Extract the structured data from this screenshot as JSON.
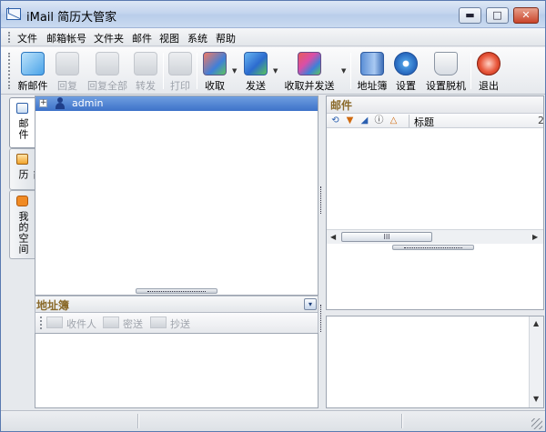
{
  "window": {
    "title": "iMail 简历大管家",
    "minimize": "▬",
    "maximize": "□",
    "close": "✕"
  },
  "menu": {
    "items": [
      "文件",
      "邮箱帐号",
      "文件夹",
      "邮件",
      "视图",
      "系统",
      "帮助"
    ]
  },
  "toolbar": {
    "new_mail": "新邮件",
    "reply": "回复",
    "reply_all": "回复全部",
    "forward": "转发",
    "print": "打印",
    "receive": "收取",
    "send": "发送",
    "receive_send": "收取并发送",
    "address_book": "地址簿",
    "settings": "设置",
    "offline_settings": "设置脱机",
    "exit": "退出"
  },
  "side_tabs": [
    "邮件",
    "简历",
    "我的空间"
  ],
  "account_tree": {
    "expander": "+",
    "account": "admin"
  },
  "address_book": {
    "title": "地址簿",
    "collapse": "▾",
    "buttons": {
      "to": "收件人",
      "bcc": "密送",
      "cc": "抄送"
    }
  },
  "mail_list": {
    "title": "邮件",
    "columns": {
      "icons": [
        "⟲",
        "▼",
        "◢",
        "ⓘ",
        "△"
      ],
      "subject": "标题",
      "edge": "2"
    },
    "hscroll": {
      "left": "◀",
      "right": "▶",
      "thumb": "III"
    }
  },
  "preview": {
    "up": "▲",
    "down": "▼"
  },
  "colors": {
    "accent_title": "#8a6a2a",
    "selection": "#3d72c9",
    "frame": "#5a7ab0"
  }
}
